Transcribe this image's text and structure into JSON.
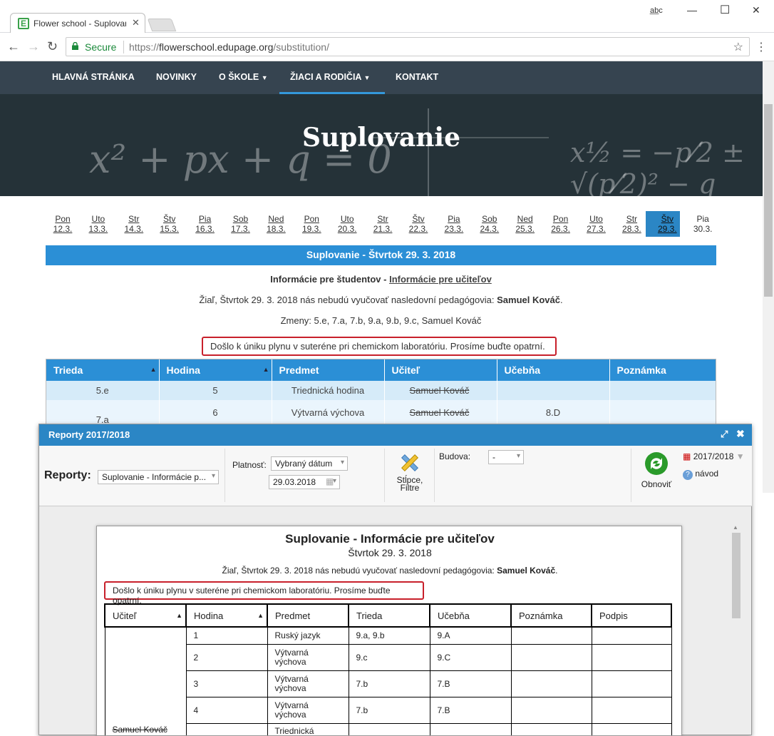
{
  "browser": {
    "tab_title": "Flower school - Suplovan",
    "secure_label": "Secure",
    "url_scheme": "https://",
    "url_host": "flowerschool.edupage.org",
    "url_path": "/substitution/"
  },
  "nav": {
    "items": [
      "HLAVNÁ STRÁNKA",
      "NOVINKY",
      "O ŠKOLE",
      "ŽIACI A RODIČIA",
      "KONTAKT"
    ]
  },
  "hero": {
    "title": "Suplovanie"
  },
  "dates": [
    {
      "day": "Pon",
      "date": "12.3."
    },
    {
      "day": "Uto",
      "date": "13.3."
    },
    {
      "day": "Str",
      "date": "14.3."
    },
    {
      "day": "Štv",
      "date": "15.3."
    },
    {
      "day": "Pia",
      "date": "16.3."
    },
    {
      "day": "Sob",
      "date": "17.3."
    },
    {
      "day": "Ned",
      "date": "18.3."
    },
    {
      "day": "Pon",
      "date": "19.3."
    },
    {
      "day": "Uto",
      "date": "20.3."
    },
    {
      "day": "Str",
      "date": "21.3."
    },
    {
      "day": "Štv",
      "date": "22.3."
    },
    {
      "day": "Pia",
      "date": "23.3."
    },
    {
      "day": "Sob",
      "date": "24.3."
    },
    {
      "day": "Ned",
      "date": "25.3."
    },
    {
      "day": "Pon",
      "date": "26.3."
    },
    {
      "day": "Uto",
      "date": "27.3."
    },
    {
      "day": "Str",
      "date": "28.3."
    },
    {
      "day": "Štv",
      "date": "29.3."
    },
    {
      "day": "Pia",
      "date": "30.3."
    }
  ],
  "banner": "Suplovanie - Štvrtok 29. 3. 2018",
  "info": {
    "students": "Informácie pre študentov",
    "dash": " - ",
    "teachers": "Informácie pre učiteľov",
    "absent_prefix": "Žiaľ, Štvrtok 29. 3. 2018 nás nebudú vyučovať nasledovní pedagógovia: ",
    "absent_name": "Samuel Kováč",
    "absent_suffix": ".",
    "changes": "Zmeny: 5.e, 7.a, 7.b, 9.a, 9.b, 9.c, Samuel Kováč",
    "message": "Došlo k úniku plynu v suteréne pri chemickom laboratóriu. Prosíme buďte opatrní."
  },
  "sub_table": {
    "headers": [
      "Trieda",
      "Hodina",
      "Predmet",
      "Učiteľ",
      "Učebňa",
      "Poznámka"
    ],
    "rows": [
      {
        "trieda": "5.e",
        "hodina": "5",
        "predmet": "Triednická hodina",
        "ucitel": "Samuel Kováč",
        "ucebna": "",
        "poznamka": ""
      },
      {
        "trieda": "7.a",
        "hodina": "6",
        "predmet": "Výtvarná výchova",
        "ucitel": "Samuel Kováč",
        "ucebna": "8.D",
        "poznamka": ""
      }
    ]
  },
  "dialog": {
    "title": "Reporty 2017/2018",
    "reporty_label": "Reporty:",
    "reporty_value": "Suplovanie - Informácie p...",
    "platnost_label": "Platnosť:",
    "platnost_value": "Vybraný dátum",
    "date_value": "29.03.2018",
    "stlpce_label_1": "Stĺpce,",
    "stlpce_label_2": "Filtre",
    "budova_label": "Budova:",
    "budova_value": "-",
    "obnovit_label": "Obnoviť",
    "year_label": "2017/2018",
    "help_label": "návod"
  },
  "document": {
    "title": "Suplovanie - Informácie pre učiteľov",
    "subtitle": "Štvrtok 29. 3. 2018",
    "absent_prefix": "Žiaľ, Štvrtok 29. 3. 2018 nás nebudú vyučovať nasledovní pedagógovia: ",
    "absent_name": "Samuel Kováč",
    "absent_suffix": ".",
    "message": "Došlo k úniku plynu v suteréne pri chemickom laboratóriu. Prosíme buďte opatrní.",
    "headers": [
      "Učiteľ",
      "Hodina",
      "Predmet",
      "Trieda",
      "Učebňa",
      "Poznámka",
      "Podpis"
    ],
    "teacher": "Samuel Kováč",
    "rows": [
      {
        "hodina": "1",
        "predmet": "Ruský jazyk",
        "trieda": "9.a, 9.b",
        "ucebna": "9.A"
      },
      {
        "hodina": "2",
        "predmet": "Výtvarná výchova",
        "trieda": "9.c",
        "ucebna": "9.C"
      },
      {
        "hodina": "3",
        "predmet": "Výtvarná výchova",
        "trieda": "7.b",
        "ucebna": "7.B"
      },
      {
        "hodina": "4",
        "predmet": "Výtvarná výchova",
        "trieda": "7.b",
        "ucebna": "7.B"
      },
      {
        "hodina": "",
        "predmet": "Triednická",
        "trieda": "",
        "ucebna": ""
      }
    ]
  },
  "colors": {
    "accent": "#2b8fd6",
    "nav_bg": "#364450",
    "alert_border": "#c8202b"
  }
}
